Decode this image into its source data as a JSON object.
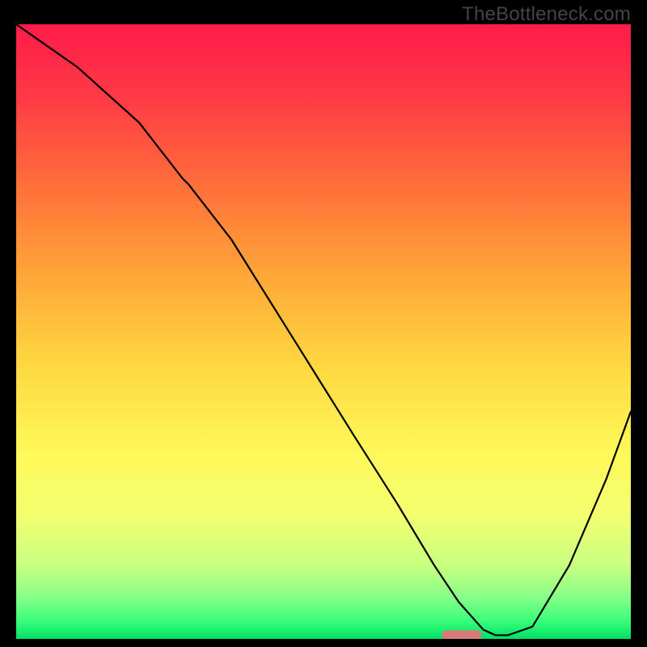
{
  "watermark": "TheBottleneck.com",
  "chart_data": {
    "type": "line",
    "title": "",
    "xlabel": "",
    "ylabel": "",
    "xlim": [
      0,
      100
    ],
    "ylim": [
      0,
      100
    ],
    "background_gradient": {
      "stops": [
        {
          "offset": 0,
          "color": "#ff1b4b"
        },
        {
          "offset": 12,
          "color": "#ff3a45"
        },
        {
          "offset": 25,
          "color": "#ff6a3b"
        },
        {
          "offset": 40,
          "color": "#ffa337"
        },
        {
          "offset": 55,
          "color": "#ffd640"
        },
        {
          "offset": 70,
          "color": "#fff95a"
        },
        {
          "offset": 80,
          "color": "#f2ff70"
        },
        {
          "offset": 88,
          "color": "#c9ff80"
        },
        {
          "offset": 93,
          "color": "#8aff88"
        },
        {
          "offset": 97,
          "color": "#3bff7a"
        },
        {
          "offset": 100,
          "color": "#00e066"
        }
      ]
    },
    "series": [
      {
        "name": "bottleneck-curve",
        "color": "#000000",
        "width": 2.2,
        "x": [
          0,
          10,
          20,
          27,
          28,
          35,
          45,
          55,
          62,
          68,
          72,
          76,
          78,
          80,
          84,
          90,
          96,
          100
        ],
        "y": [
          100,
          93,
          84,
          75,
          74,
          65,
          49,
          33,
          22,
          12,
          6,
          1.5,
          0.6,
          0.6,
          2,
          12,
          26,
          37
        ]
      }
    ],
    "marker": {
      "name": "optimal-range",
      "shape": "rounded-rect",
      "color": "#d97a7a",
      "x": 72.5,
      "y": 0.6,
      "width": 6.5,
      "height": 1.6,
      "rx": 0.8
    }
  }
}
